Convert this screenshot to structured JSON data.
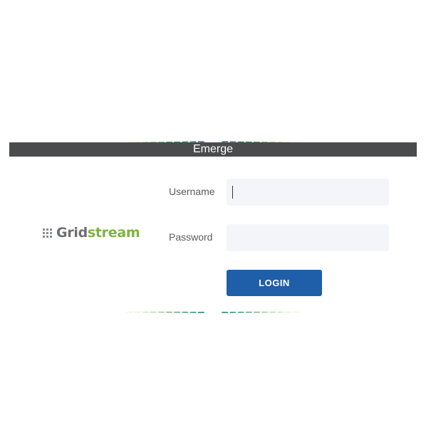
{
  "app": {
    "title": "Emerge"
  },
  "logo": {
    "word_part1": "Grid",
    "word_part2": "stream"
  },
  "form": {
    "username_label": "Username",
    "username_value": "",
    "password_label": "Password",
    "password_value": "",
    "login_label": "LOGIN"
  },
  "colors": {
    "title_bar": "#4a4b4d",
    "login_button": "#1f5ea8",
    "input_background": "#f4f5f8",
    "logo_green": "#7cb342",
    "logo_gray": "#6d6e71",
    "banner_green": "#8cc152",
    "banner_teal": "#1f7a78"
  }
}
